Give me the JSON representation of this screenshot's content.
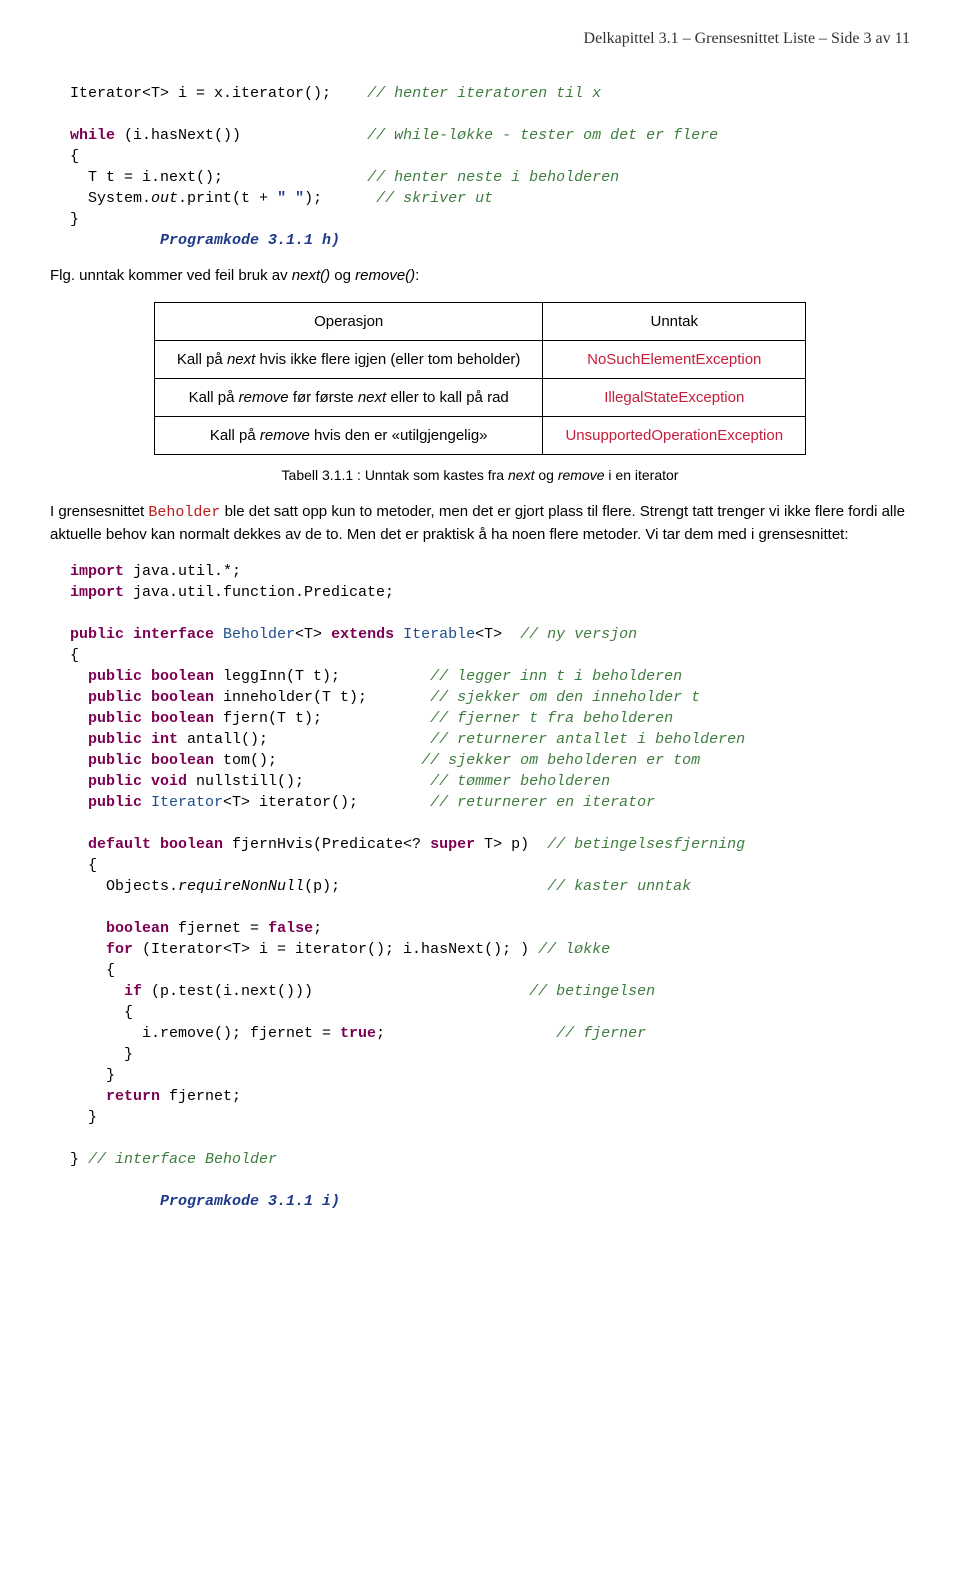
{
  "header": {
    "chapter": "Delkapittel 3.1",
    "title": "Grensesnittet Liste",
    "page_label": "Side 3 av 11",
    "sep": " – "
  },
  "code1": {
    "l1a": "Iterator<T> i = x.iterator();    ",
    "l1b": "// henter iteratoren til x",
    "l2a": "while",
    "l2b": " (i.hasNext())              ",
    "l2c": "// while-løkke - tester om det er flere",
    "l3": "{",
    "l4a": "  T t = i.next();                ",
    "l4b": "// henter neste i beholderen",
    "l5a": "  System.",
    "l5b": "out",
    "l5c": ".print(t + ",
    "l5d": "\" \"",
    "l5e": ");      ",
    "l5f": "// skriver ut",
    "l6": "}",
    "l7": "          Programkode 3.1.1 h)"
  },
  "para1": {
    "pre": "Flg. unntak kommer ved feil bruk av ",
    "m1": "next()",
    "mid": " og ",
    "m2": "remove()",
    "post": ":"
  },
  "table": {
    "h1": "Operasjon",
    "h2": "Unntak",
    "r1c1a": "Kall på ",
    "r1c1b": "next",
    "r1c1c": " hvis ikke flere igjen (eller tom beholder)",
    "r1c2": "NoSuchElementException",
    "r2c1a": "Kall på ",
    "r2c1b": "remove",
    "r2c1c": " før første ",
    "r2c1d": "next",
    "r2c1e": " eller to kall på rad",
    "r2c2": "IllegalStateException",
    "r3c1a": "Kall på ",
    "r3c1b": "remove",
    "r3c1c": " hvis den er «utilgjengelig»",
    "r3c2": "UnsupportedOperationException"
  },
  "caption": {
    "a": "Tabell 3.1.1 : Unntak som kastes fra ",
    "b": "next",
    "c": " og ",
    "d": "remove",
    "e": " i en iterator"
  },
  "para2": {
    "a": "I grensesnittet ",
    "b": "Beholder",
    "c": " ble det satt opp kun to metoder, men det er gjort plass til flere. Strengt tatt trenger vi ikke flere fordi alle aktuelle behov kan normalt dekkes av de to. Men det er praktisk å ha noen flere metoder. Vi tar dem med i grensesnittet:"
  },
  "code2": {
    "l1a": "import",
    "l1b": " java.util.*;",
    "l2a": "import",
    "l2b": " java.util.function.Predicate;",
    "l4a": "public interface ",
    "l4b": "Beholder",
    "l4c": "<T> ",
    "l4d": "extends ",
    "l4e": "Iterable",
    "l4f": "<T>  ",
    "l4g": "// ny versjon",
    "l5": "{",
    "l6a": "  public boolean",
    "l6b": " leggInn(T t);          ",
    "l6c": "// legger inn t i beholderen",
    "l7a": "  public boolean",
    "l7b": " inneholder(T t);       ",
    "l7c": "// sjekker om den inneholder t",
    "l8a": "  public boolean",
    "l8b": " fjern(T t);            ",
    "l8c": "// fjerner t fra beholderen",
    "l9a": "  public int",
    "l9b": " antall();                  ",
    "l9c": "// returnerer antallet i beholderen",
    "l10a": "  public boolean",
    "l10b": " tom();                ",
    "l10c": "// sjekker om beholderen er tom",
    "l11a": "  public void",
    "l11b": " nullstill();              ",
    "l11c": "// tømmer beholderen",
    "l12a": "  public ",
    "l12b": "Iterator",
    "l12c": "<T> iterator();        ",
    "l12d": "// returnerer en iterator",
    "l14a": "  default boolean",
    "l14b": " fjernHvis(Predicate<? ",
    "l14c": "super",
    "l14d": " T> p)  ",
    "l14e": "// betingelsesfjerning",
    "l15": "  {",
    "l16a": "    Objects.",
    "l16b": "requireNonNull",
    "l16c": "(p);                       ",
    "l16d": "// kaster unntak",
    "l18a": "    boolean",
    "l18b": " fjernet = ",
    "l18c": "false",
    "l18d": ";",
    "l19a": "    for ",
    "l19b": "(Iterator<T> i = iterator(); i.hasNext(); ) ",
    "l19c": "// løkke",
    "l20": "    {",
    "l21a": "      if ",
    "l21b": "(p.test(i.next()))                        ",
    "l21c": "// betingelsen",
    "l22": "      {",
    "l23a": "        i.remove(); fjernet = ",
    "l23b": "true",
    "l23c": ";                   ",
    "l23d": "// fjerner",
    "l24": "      }",
    "l25": "    }",
    "l26a": "    return ",
    "l26b": "fjernet;",
    "l27": "  }",
    "l29a": "} ",
    "l29b": "// interface Beholder",
    "l31": "          Programkode 3.1.1 i)"
  }
}
